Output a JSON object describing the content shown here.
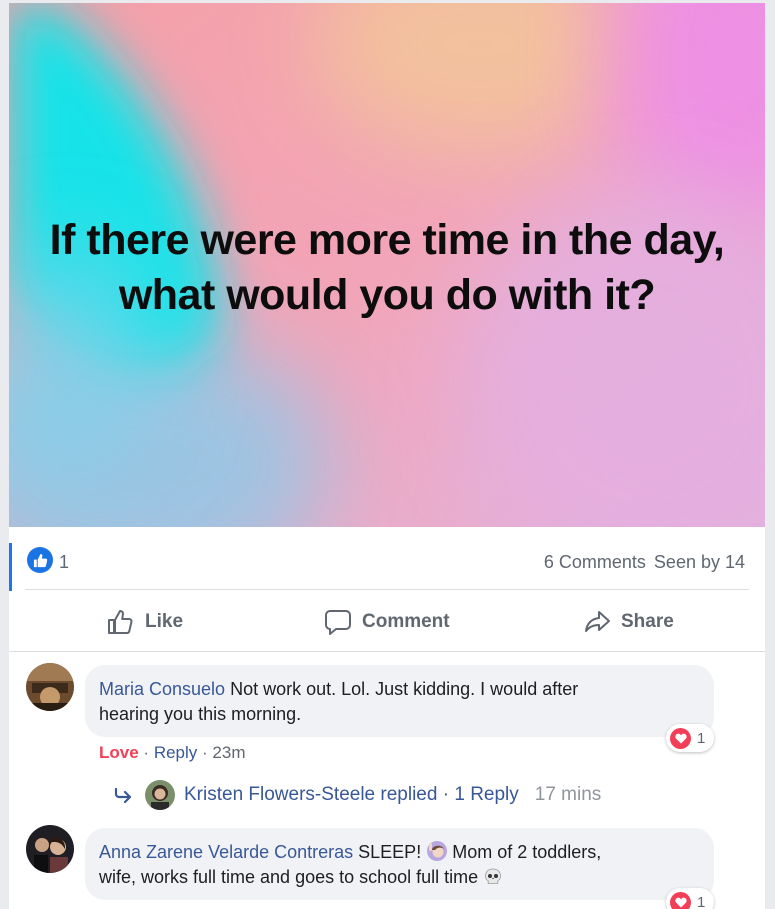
{
  "post": {
    "text": "If there were more time in the day, what would you do with it?"
  },
  "stats": {
    "like_count": "1",
    "comments": "6 Comments",
    "seen_by": "Seen by 14"
  },
  "actions": {
    "like": "Like",
    "comment": "Comment",
    "share": "Share"
  },
  "comments": [
    {
      "author": "Maria Consuelo",
      "text_line1": " Not work out. Lol. Just kidding. I would after",
      "text_line2": "hearing you this morning.",
      "reaction_label": "Love",
      "reply_label": "Reply",
      "time": "23m",
      "reaction_count": "1",
      "replies": {
        "author": "Kristen Flowers-Steele replied",
        "count": "1 Reply",
        "time": "17 mins"
      }
    },
    {
      "author": "Anna Zarene Velarde Contreras",
      "text_line1_a": " SLEEP! ",
      "text_line1_b": "Mom of 2 toddlers,",
      "text_line2": "wife, works full time and goes to school full time ",
      "reaction_count": "1"
    }
  ],
  "colors": {
    "link": "#385898",
    "love": "#f33e58",
    "like_blue": "#1b74e4"
  }
}
